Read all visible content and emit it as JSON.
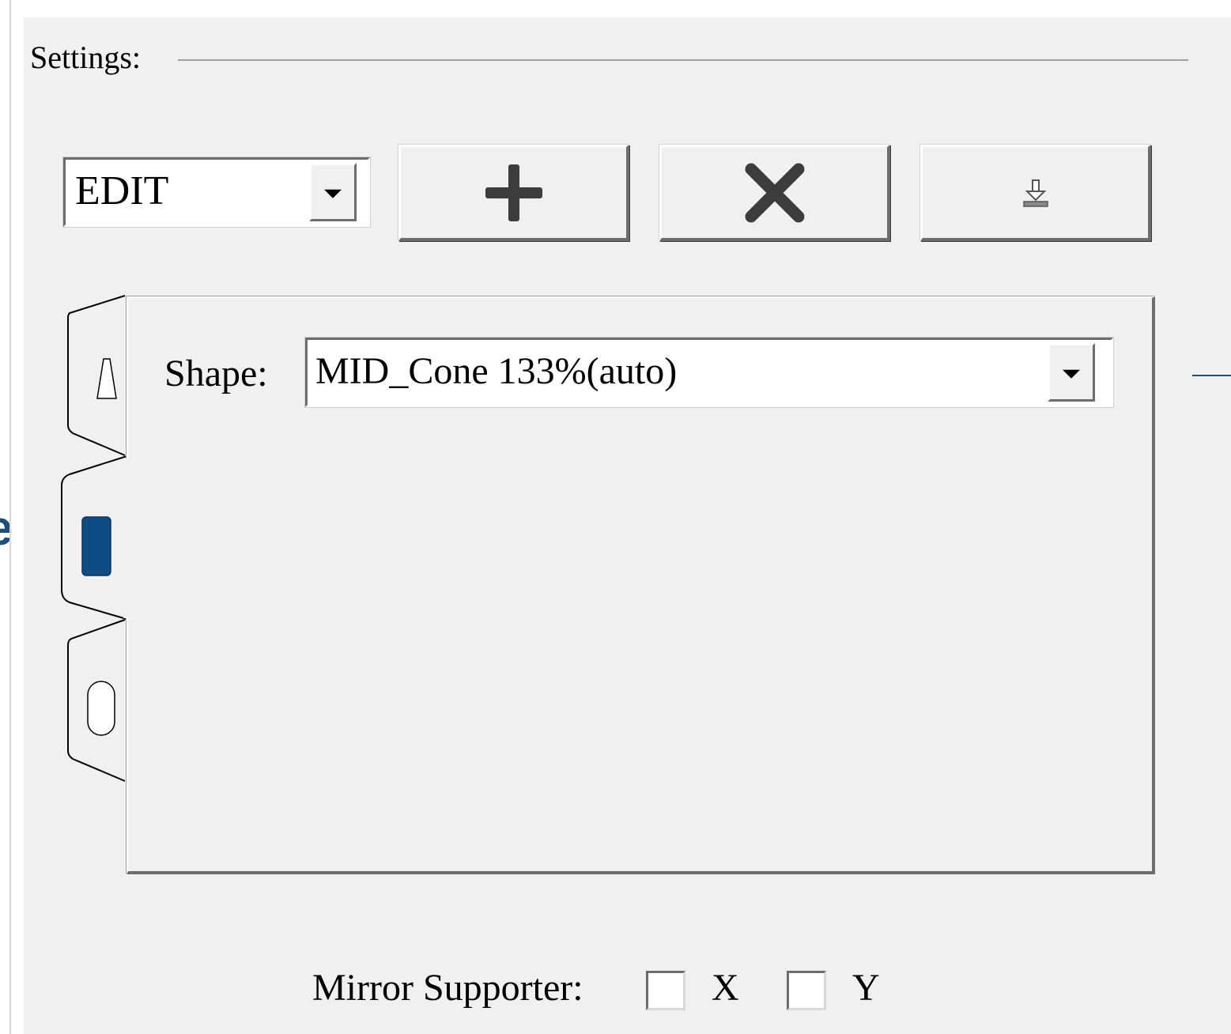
{
  "settings": {
    "caption": "Settings:"
  },
  "mode_combo": {
    "value": "EDIT"
  },
  "toolbar": {
    "add_icon": "plus-icon",
    "delete_icon": "x-icon",
    "export_icon": "download-icon"
  },
  "tabs": [
    {
      "icon": "cone-outline-icon",
      "selected": false
    },
    {
      "icon": "cylinder-filled-icon",
      "selected": true
    },
    {
      "icon": "capsule-outline-icon",
      "selected": false
    }
  ],
  "shape": {
    "label": "Shape:",
    "value": "MID_Cone 133%(auto)"
  },
  "mirror": {
    "label": "Mirror Supporter:",
    "x_label": "X",
    "y_label": "Y",
    "x_checked": false,
    "y_checked": false
  },
  "left_edge": {
    "letter": "e"
  },
  "colors": {
    "panel_bg": "#f0f0f0",
    "accent": "#1f4e7a",
    "shadow": "#6d6d6d"
  }
}
